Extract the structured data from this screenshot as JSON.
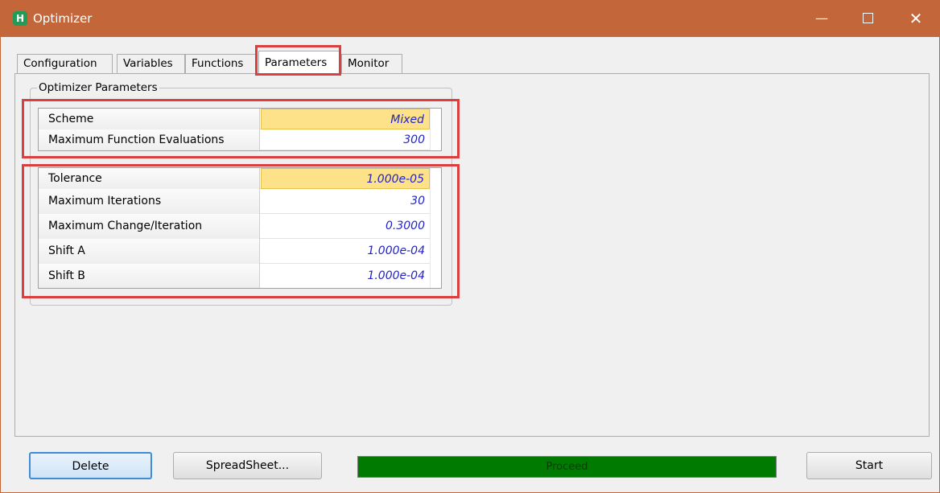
{
  "window": {
    "title": "Optimizer",
    "app_icon_letter": "H",
    "minimize_glyph": "—",
    "close_glyph": "✕"
  },
  "tabs": [
    {
      "label": "Configuration"
    },
    {
      "label": "Variables"
    },
    {
      "label": "Functions"
    },
    {
      "label": "Parameters",
      "active": true
    },
    {
      "label": "Monitor"
    }
  ],
  "group": {
    "label": "Optimizer Parameters",
    "primary": [
      {
        "label": "Scheme",
        "value": "Mixed",
        "selected": true
      },
      {
        "label": "Maximum Function Evaluations",
        "value": "300"
      }
    ],
    "secondary": [
      {
        "label": "Tolerance",
        "value": "1.000e-05",
        "selected": true
      },
      {
        "label": "Maximum Iterations",
        "value": "30"
      },
      {
        "label": "Maximum Change/Iteration",
        "value": "0.3000"
      },
      {
        "label": "Shift A",
        "value": "1.000e-04"
      },
      {
        "label": "Shift B",
        "value": "1.000e-04"
      }
    ]
  },
  "footer": {
    "delete_label": "Delete",
    "spreadsheet_label": "SpreadSheet...",
    "start_label": "Start",
    "progress_text": "Proceed",
    "progress_fraction": 1.0
  },
  "colors": {
    "titlebar": "#c3663a",
    "highlight": "#d9403f",
    "progress": "#007a00",
    "selected_cell": "#fde28a",
    "value_text": "#2323c8"
  }
}
